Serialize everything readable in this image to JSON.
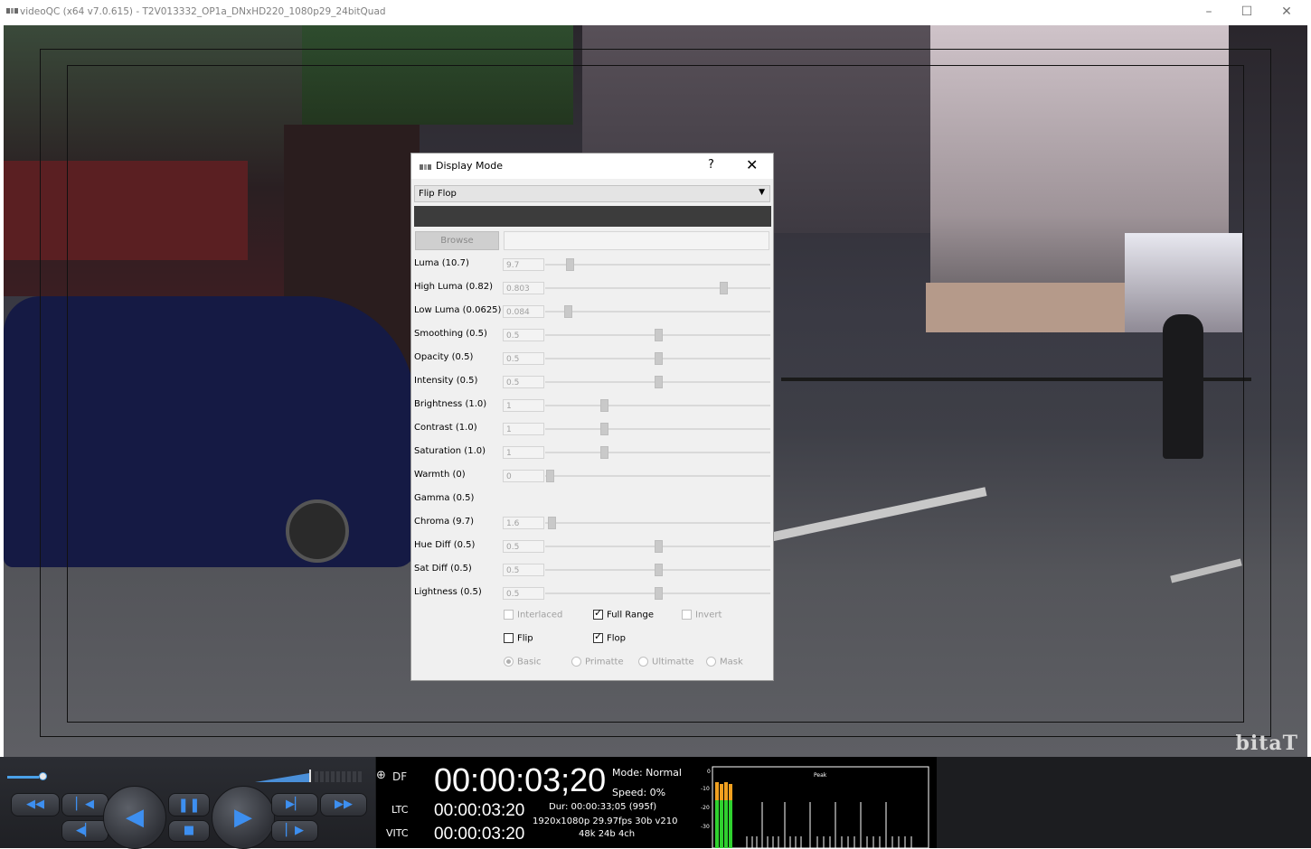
{
  "window": {
    "title": "videoQC (x64 v7.0.615) - T2V013332_OP1a_DNxHD220_1080p29_24bitQuad",
    "minimize_glyph": "–",
    "maximize_glyph": "☐",
    "close_glyph": "✕"
  },
  "viewport": {
    "watermark": "bitaT"
  },
  "dialog": {
    "title": "Display Mode",
    "help_glyph": "?",
    "close_glyph": "✕",
    "mode_select": "Flip Flop",
    "browse_label": "Browse",
    "params": [
      {
        "label": "Luma (10.7)",
        "value": "9.7",
        "level": 0.11
      },
      {
        "label": "High Luma (0.82)",
        "value": "0.803",
        "level": 0.79
      },
      {
        "label": "Low Luma (0.0625)",
        "value": "0.084",
        "level": 0.1
      },
      {
        "label": "Smoothing (0.5)",
        "value": "0.5",
        "level": 0.5
      },
      {
        "label": "Opacity (0.5)",
        "value": "0.5",
        "level": 0.5
      },
      {
        "label": "Intensity (0.5)",
        "value": "0.5",
        "level": 0.5
      },
      {
        "label": "Brightness (1.0)",
        "value": "1",
        "level": 0.26
      },
      {
        "label": "Contrast (1.0)",
        "value": "1",
        "level": 0.26
      },
      {
        "label": "Saturation (1.0)",
        "value": "1",
        "level": 0.26
      },
      {
        "label": "Warmth (0)",
        "value": "0",
        "level": 0.02
      },
      {
        "label": "Gamma (0.5)",
        "value": "",
        "level": null
      },
      {
        "label": "Chroma (9.7)",
        "value": "1.6",
        "level": 0.03
      },
      {
        "label": "Hue Diff (0.5)",
        "value": "0.5",
        "level": 0.5
      },
      {
        "label": "Sat Diff (0.5)",
        "value": "0.5",
        "level": 0.5
      },
      {
        "label": "Lightness (0.5)",
        "value": "0.5",
        "level": 0.5
      }
    ],
    "options": {
      "interlaced": {
        "label": "Interlaced",
        "checked": false,
        "enabled": false
      },
      "full_range": {
        "label": "Full Range",
        "checked": true,
        "enabled": true
      },
      "invert": {
        "label": "Invert",
        "checked": false,
        "enabled": false
      },
      "flip": {
        "label": "Flip",
        "checked": false,
        "enabled": true
      },
      "flop": {
        "label": "Flop",
        "checked": true,
        "enabled": true
      }
    },
    "radios": {
      "basic": "Basic",
      "primatte": "Primatte",
      "ultimatte": "Ultimatte",
      "mask": "Mask",
      "selected": "basic"
    },
    "check_glyph": "✓"
  },
  "player": {
    "position": 0.09,
    "icons": {
      "rewind": "◀◀",
      "prev": "▏◀",
      "step_back": "◀▏",
      "play_back": "◀",
      "pause": "❚❚",
      "stop": "■",
      "play": "▶",
      "next": "▶▏",
      "step_fwd": "▏▶",
      "ffwd": "▶▶"
    }
  },
  "timecode": {
    "df_icon": "⊕",
    "df_label": "DF",
    "main": "00:00:03;20",
    "mode": "Mode: Normal",
    "speed": "Speed: 0%",
    "ltc_label": "LTC",
    "ltc": "00:00:03:20",
    "vitc_label": "VITC",
    "vitc": "00:00:03:20",
    "duration": "Dur: 00:00:33;05 (995f)",
    "format": "1920x1080p 29.97fps 30b v210",
    "audio": "48k 24b 4ch"
  },
  "meter": {
    "title": "Peak",
    "scale": [
      "0",
      "-10",
      "-20",
      "-30"
    ]
  },
  "colors": {
    "accent_blue": "#3d8ff0",
    "meter_green": "#2fd12f",
    "meter_orange": "#f0a020"
  }
}
